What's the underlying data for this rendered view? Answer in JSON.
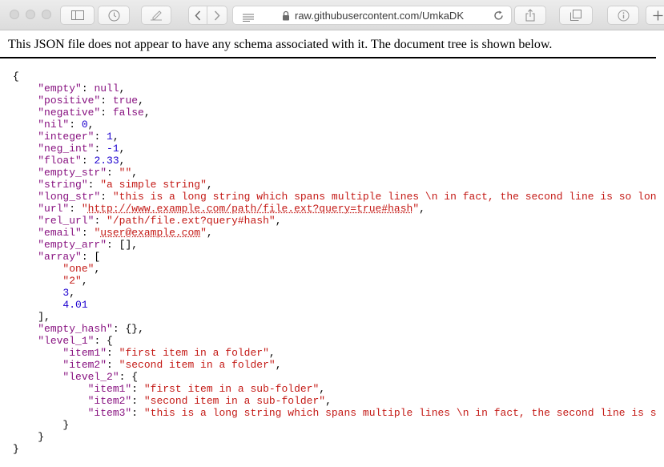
{
  "browser": {
    "address": "raw.githubusercontent.com/UmkaDK",
    "icons": [
      "sidebar-icon",
      "history-icon",
      "edit-icon",
      "back-icon",
      "forward-icon",
      "reader-icon",
      "lock-icon",
      "reload-icon",
      "share-icon",
      "tabs-icon",
      "info-icon",
      "plus-icon"
    ]
  },
  "page": {
    "notice": "This JSON file does not appear to have any schema associated with it. The document tree is shown below."
  },
  "json": {
    "root_open": "{",
    "empty_key": "\"empty\"",
    "empty_val": "null",
    "positive_key": "\"positive\"",
    "positive_val": "true",
    "negative_key": "\"negative\"",
    "negative_val": "false",
    "nil_key": "\"nil\"",
    "nil_val": "0",
    "integer_key": "\"integer\"",
    "integer_val": "1",
    "neg_int_key": "\"neg_int\"",
    "neg_int_val": "-1",
    "float_key": "\"float\"",
    "float_val": "2.33",
    "empty_str_key": "\"empty_str\"",
    "empty_str_val": "\"\"",
    "string_key": "\"string\"",
    "string_val": "\"a simple string\"",
    "long_str_key": "\"long_str\"",
    "long_str_val": "\"this is a long string which spans multiple lines \\n in fact, the second line is so lon",
    "url_key": "\"url\"",
    "url_val": "http://www.example.com/path/file.ext?query=true#hash",
    "rel_url_key": "\"rel_url\"",
    "rel_url_val": "\"/path/file.ext?query#hash\"",
    "email_key": "\"email\"",
    "email_val": "user@example.com",
    "empty_arr_key": "\"empty_arr\"",
    "empty_arr_val": "[]",
    "array_key": "\"array\"",
    "array_items": [
      "\"one\"",
      "\"2\"",
      "3",
      "4.01"
    ],
    "empty_hash_key": "\"empty_hash\"",
    "empty_hash_val": "{}",
    "level_1_key": "\"level_1\"",
    "l1_item1_key": "\"item1\"",
    "l1_item1_val": "\"first item in a folder\"",
    "l1_item2_key": "\"item2\"",
    "l1_item2_val": "\"second item in a folder\"",
    "level_2_key": "\"level_2\"",
    "l2_item1_key": "\"item1\"",
    "l2_item1_val": "\"first item in a sub-folder\"",
    "l2_item2_key": "\"item2\"",
    "l2_item2_val": "\"second item in a sub-folder\"",
    "l2_item3_key": "\"item3\"",
    "l2_item3_val": "\"this is a long string which spans multiple lines \\n in fact, the second line is s"
  }
}
